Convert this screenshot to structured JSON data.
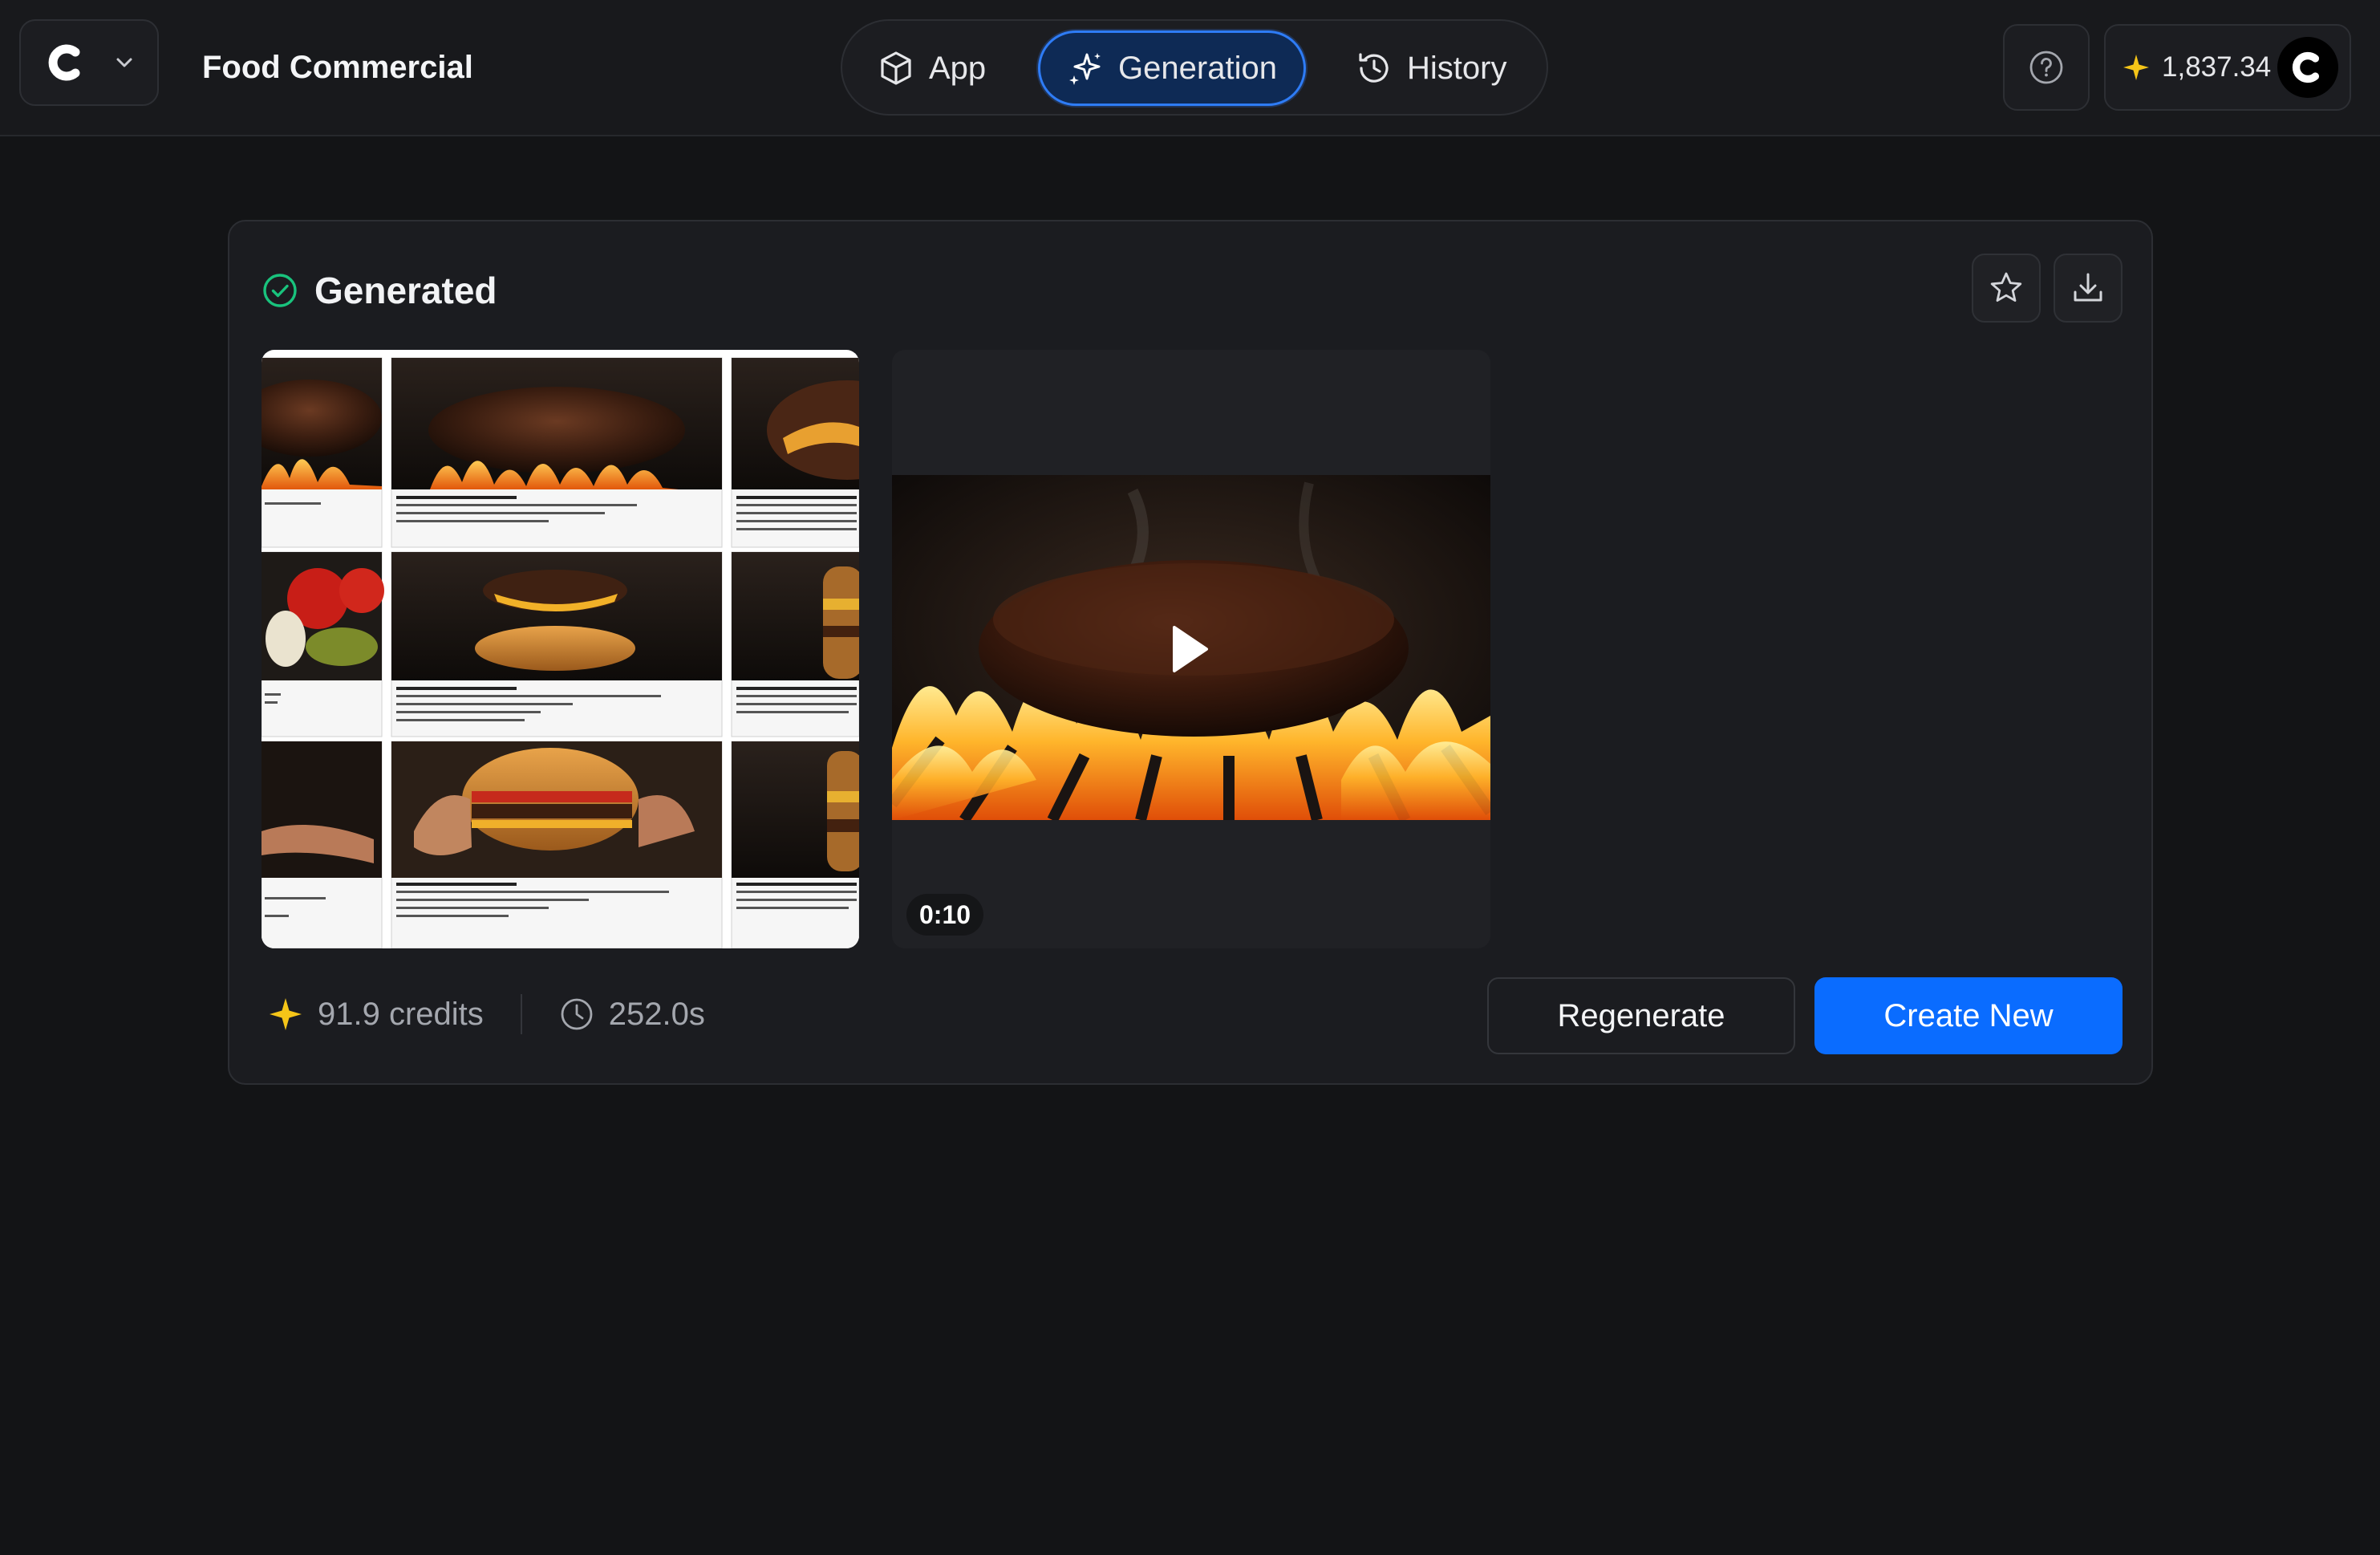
{
  "header": {
    "project_title": "Food Commercial",
    "tabs": [
      {
        "label": "App",
        "icon": "cube-icon",
        "active": false
      },
      {
        "label": "Generation",
        "icon": "sparkles-icon",
        "active": true
      },
      {
        "label": "History",
        "icon": "history-icon",
        "active": false
      }
    ],
    "credits_balance": "1,837.34",
    "accent_color": "#2e7cf6"
  },
  "result": {
    "status": "Generated",
    "status_color": "#19c37d",
    "actions": {
      "favorite_icon": "star-icon",
      "download_icon": "download-icon"
    },
    "storyboard_panels": [
      {
        "caption": "and inevitability."
      },
      {
        "caption": "02 — 00:02-00:03.5  HEAT BLOOM",
        "lines": [
          "Flame transforms beef into a glossy, primal centerpiece with controlled fury.",
          "CAM: Slow-motion tracking across charred surface, lateral move.",
          "SFX: Flame burst, crackle, rich sizzle."
        ]
      },
      {
        "caption": "03 — 00:03.5-00:05  TEXTURE REVEAL",
        "lines": [
          "Char, melt, and moisture signal dense indu",
          "CAM: Macro orbit around cheese edge a",
          "SFX: Soft steam release, subtle crunch",
          "MUSIC: Percussive pulse joins, restrain"
        ]
      },
      {
        "caption": "ans. boil."
      },
      {
        "caption": "05 — 00:06.5-00:08.5  ASSEMBLY",
        "lines": [
          "The burger is composed with ceremonial precision, each layer adding weight and staking.",
          "CAM: Floating build shot, centered vertical stack.",
          "SFX: Natural food handling, soft bun contact.",
          "MUSIC: Bass deepens, momentum rises."
        ]
      },
      {
        "caption": "06 — 00:08.5-00:10  FRESH REVEAL",
        "lines": [
          "The full tower stands complete, rich, polis",
          "CAM: Hero push-in from medium to tigh",
          "SFX: Steam release, faint room tone."
        ]
      },
      {
        "caption": "richness and reward. friction."
      },
      {
        "caption": "09 — 00:11.5-00:13  FIRST BITE",
        "lines": [
          "Anticipation resolves into surrender through heat, crunch, softness, and dense satisfaction.",
          "CAM: Intimate close-up, slight handheld stable drift.",
          "SFX: Bite, crunch, dense chew texture.",
          "MUSIC: Peak indulgence, then taper."
        ]
      },
      {
        "caption": "09 — 00:13-00:15  HERO STILL",
        "lines": [
          "The final memory is pure product: towerin",
          "CAM: Static hero composition, minimal",
          "SFX: Ambient tail, residual heat."
        ]
      }
    ],
    "video": {
      "duration": "0:10"
    },
    "credits_used": "91.9 credits",
    "elapsed_time": "252.0s",
    "buttons": {
      "regenerate": "Regenerate",
      "create_new": "Create New"
    }
  }
}
